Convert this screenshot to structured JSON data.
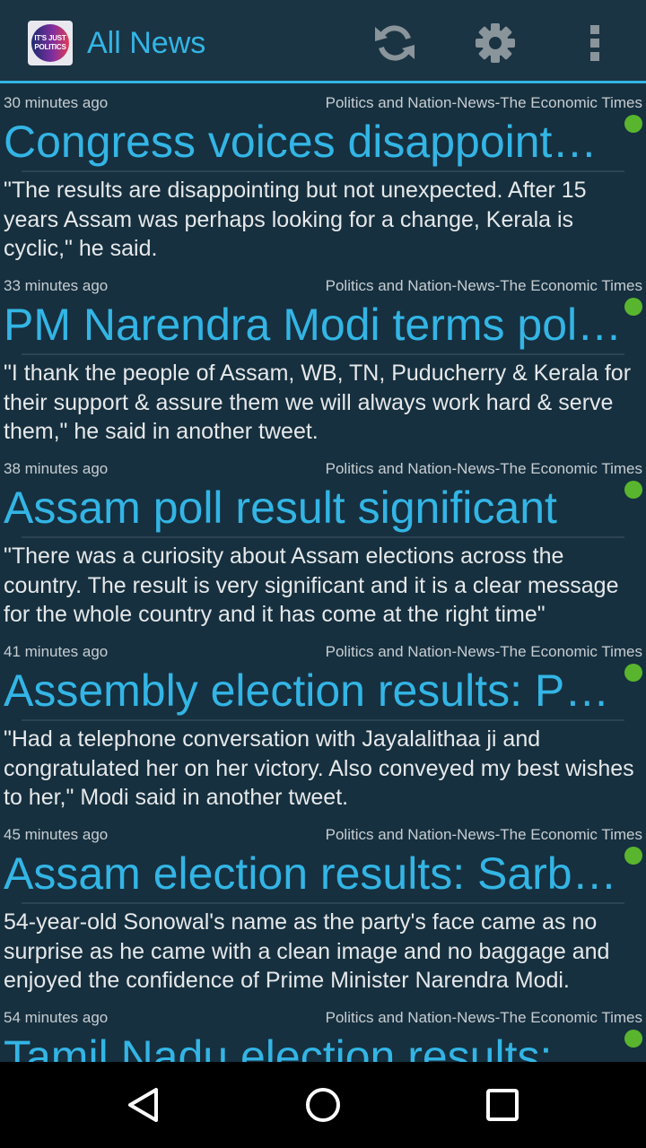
{
  "app_bar": {
    "title": "All News",
    "logo_text": [
      "IT'S JUST",
      "POLITICS"
    ],
    "actions": [
      "refresh-icon",
      "settings-icon",
      "overflow-menu-icon"
    ]
  },
  "colors": {
    "accent": "#33b5e5",
    "background": "#16303f",
    "unread_dot": "#59b52e"
  },
  "news_items": [
    {
      "time": "30 minutes ago",
      "source": "Politics and Nation-News-The Economic Times",
      "headline": "Congress voices disappointment over poll results",
      "snippet": "\"The results are disappointing but not unexpected. After 15 years Assam was perhaps looking for a change, Kerala is cyclic,\" he said."
    },
    {
      "time": "33 minutes ago",
      "source": "Politics and Nation-News-The Economic Times",
      "headline": "PM Narendra Modi terms poll results",
      "snippet": "\"I thank the people of Assam, WB, TN, Puducherry & Kerala for their support & assure them we will always work hard & serve them,\" he said in another tweet."
    },
    {
      "time": "38 minutes ago",
      "source": "Politics and Nation-News-The Economic Times",
      "headline": "Assam poll result significant",
      "snippet": "\"There was a curiosity about Assam elections across the country. The result is very significant and it is a clear message for the whole country and it has come at the right time\""
    },
    {
      "time": "41 minutes ago",
      "source": "Politics and Nation-News-The Economic Times",
      "headline": "Assembly election results: PM Modi",
      "snippet": "\"Had a telephone conversation with Jayalalithaa ji and congratulated her on her victory. Also conveyed my best wishes to her,\" Modi said in another tweet."
    },
    {
      "time": "45 minutes ago",
      "source": "Politics and Nation-News-The Economic Times",
      "headline": "Assam election results: Sarbananda Sonowal",
      "snippet": "54-year-old Sonowal's name as the party's face came as no surprise as he came with a clean image and no baggage and enjoyed the confidence of Prime Minister Narendra Modi."
    },
    {
      "time": "54 minutes ago",
      "source": "Politics and Nation-News-The Economic Times",
      "headline": "Tamil Nadu election results:",
      "snippet": ""
    }
  ],
  "nav_bar": [
    "back-icon",
    "home-icon",
    "recents-icon"
  ]
}
